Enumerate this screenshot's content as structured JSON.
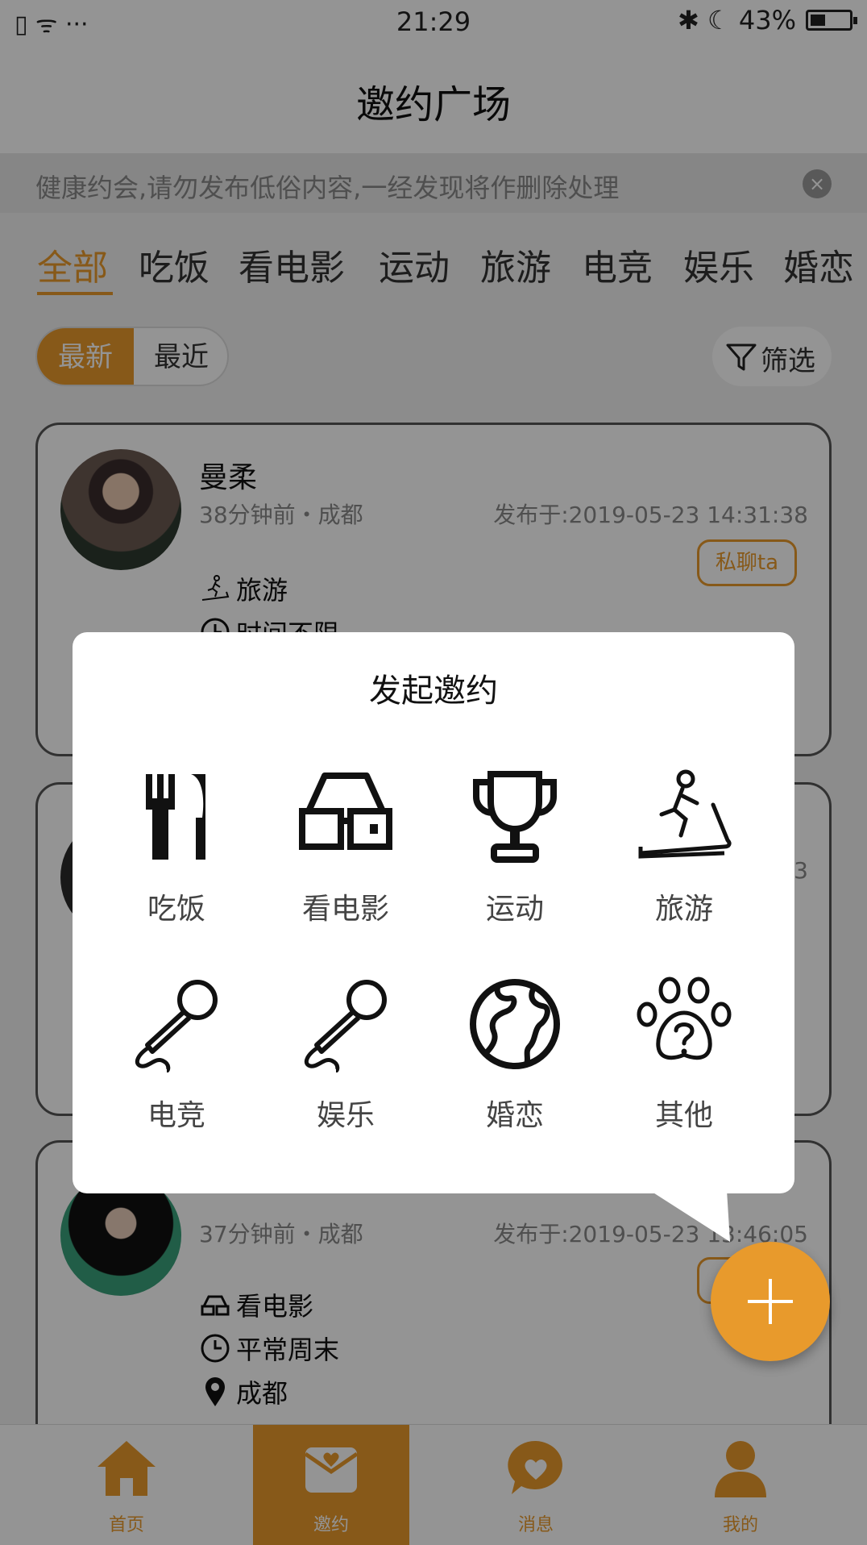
{
  "status_bar": {
    "left": "▯ ᯤ ···",
    "time": "21:29",
    "right": "✱ ☾ 43%"
  },
  "header": {
    "title": "邀约广场"
  },
  "notice": {
    "text": "健康约会,请勿发布低俗内容,一经发现将作删除处理",
    "close_glyph": "×"
  },
  "tabs": [
    "全部",
    "吃饭",
    "看电影",
    "运动",
    "旅游",
    "电竞",
    "娱乐",
    "婚恋"
  ],
  "active_tab": "全部",
  "sort": {
    "latest": "最新",
    "nearby": "最近"
  },
  "filter_label": "筛选",
  "cards": [
    {
      "name": "曼柔",
      "meta": "38分钟前・成都",
      "date": "发布于:2019-05-23 14:31:38",
      "chat_label": "私聊ta",
      "activity": "旅游",
      "time_pref": "时间不限"
    },
    {
      "meta": "",
      "date_suffix": "3"
    },
    {
      "meta": "37分钟前・成都",
      "date": "发布于:2019-05-23 13:46:05",
      "activity": "看电影",
      "time_pref": "平常周末",
      "location": "成都"
    }
  ],
  "tabbar": [
    {
      "label": "首页",
      "icon": "home-icon"
    },
    {
      "label": "邀约",
      "icon": "invite-icon"
    },
    {
      "label": "消息",
      "icon": "message-icon"
    },
    {
      "label": "我的",
      "icon": "profile-icon"
    }
  ],
  "popup": {
    "title": "发起邀约",
    "categories": [
      {
        "label": "吃饭",
        "icon": "fork-knife-icon"
      },
      {
        "label": "看电影",
        "icon": "glasses-3d-icon"
      },
      {
        "label": "运动",
        "icon": "trophy-icon"
      },
      {
        "label": "旅游",
        "icon": "treadmill-icon"
      },
      {
        "label": "电竞",
        "icon": "microphone-icon"
      },
      {
        "label": "娱乐",
        "icon": "microphone-icon"
      },
      {
        "label": "婚恋",
        "icon": "globe-icon"
      },
      {
        "label": "其他",
        "icon": "paw-question-icon"
      }
    ]
  },
  "colors": {
    "accent": "#e89a2c"
  }
}
